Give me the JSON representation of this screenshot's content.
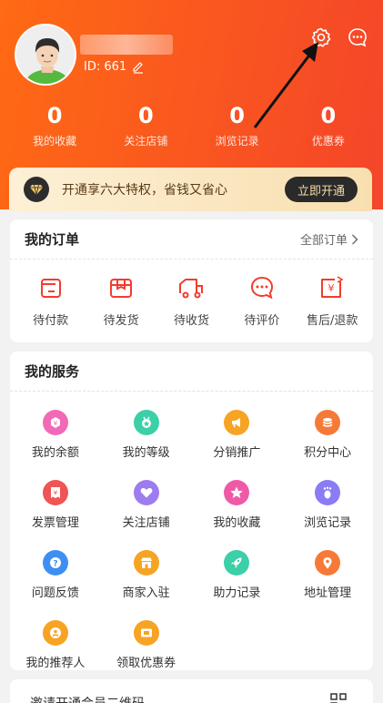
{
  "profile": {
    "user_id": "ID: 661"
  },
  "stats": [
    {
      "value": "0",
      "label": "我的收藏"
    },
    {
      "value": "0",
      "label": "关注店铺"
    },
    {
      "value": "0",
      "label": "浏览记录"
    },
    {
      "value": "0",
      "label": "优惠券"
    }
  ],
  "vip": {
    "text": "开通享六大特权，省钱又省心",
    "button": "立即开通"
  },
  "orders": {
    "title": "我的订单",
    "all_label": "全部订单",
    "items": [
      {
        "label": "待付款",
        "icon": "wallet-icon"
      },
      {
        "label": "待发货",
        "icon": "box-icon"
      },
      {
        "label": "待收货",
        "icon": "truck-icon"
      },
      {
        "label": "待评价",
        "icon": "comment-icon"
      },
      {
        "label": "售后/退款",
        "icon": "refund-icon"
      }
    ]
  },
  "services": {
    "title": "我的服务",
    "items": [
      {
        "label": "我的余额",
        "icon": "balance-icon",
        "color": "#f06ab8"
      },
      {
        "label": "我的等级",
        "icon": "level-icon",
        "color": "#3ccfa8"
      },
      {
        "label": "分销推广",
        "icon": "megaphone-icon",
        "color": "#f7a324"
      },
      {
        "label": "积分中心",
        "icon": "points-icon",
        "color": "#f57a38"
      },
      {
        "label": "发票管理",
        "icon": "invoice-icon",
        "color": "#f05454"
      },
      {
        "label": "关注店铺",
        "icon": "heart-icon",
        "color": "#9d7cf0"
      },
      {
        "label": "我的收藏",
        "icon": "star-icon",
        "color": "#ef5aa8"
      },
      {
        "label": "浏览记录",
        "icon": "footprint-icon",
        "color": "#8a7cf5"
      },
      {
        "label": "问题反馈",
        "icon": "question-icon",
        "color": "#3f8ff2"
      },
      {
        "label": "商家入驻",
        "icon": "store-icon",
        "color": "#f7a324"
      },
      {
        "label": "助力记录",
        "icon": "rocket-icon",
        "color": "#3ccfa8"
      },
      {
        "label": "地址管理",
        "icon": "location-icon",
        "color": "#f57a38"
      },
      {
        "label": "我的推荐人",
        "icon": "referrer-icon",
        "color": "#f7a324"
      },
      {
        "label": "领取优惠券",
        "icon": "coupon-icon",
        "color": "#f7a324"
      }
    ]
  },
  "invite": {
    "text": "邀请开通会员二维码"
  },
  "colors": {
    "header_start": "#ff6a14",
    "header_end": "#f4452a",
    "accent": "#f23c2e"
  }
}
